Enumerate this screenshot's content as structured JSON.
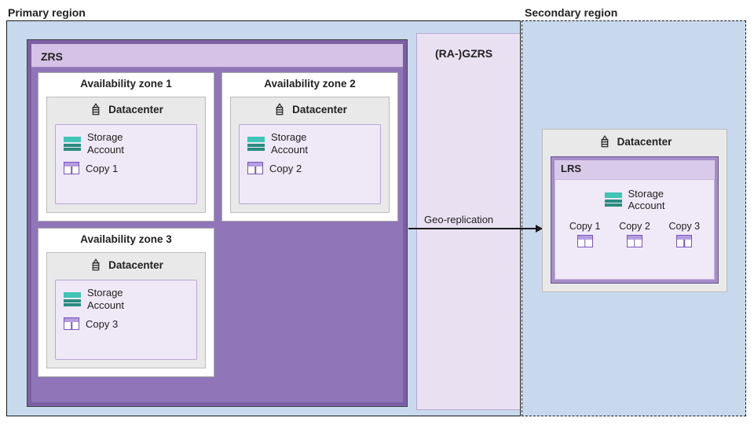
{
  "labels": {
    "primary_region": "Primary region",
    "secondary_region": "Secondary region",
    "zrs": "ZRS",
    "ra_gzrs": "(RA-)GZRS",
    "geo_replication": "Geo-replication",
    "datacenter": "Datacenter",
    "storage_account": "Storage\nAccount",
    "lrs": "LRS"
  },
  "zones": [
    {
      "title": "Availability zone 1",
      "copy": "Copy 1"
    },
    {
      "title": "Availability zone 2",
      "copy": "Copy 2"
    },
    {
      "title": "Availability zone 3",
      "copy": "Copy 3"
    }
  ],
  "secondary": {
    "copies": [
      "Copy 1",
      "Copy 2",
      "Copy 3"
    ]
  }
}
